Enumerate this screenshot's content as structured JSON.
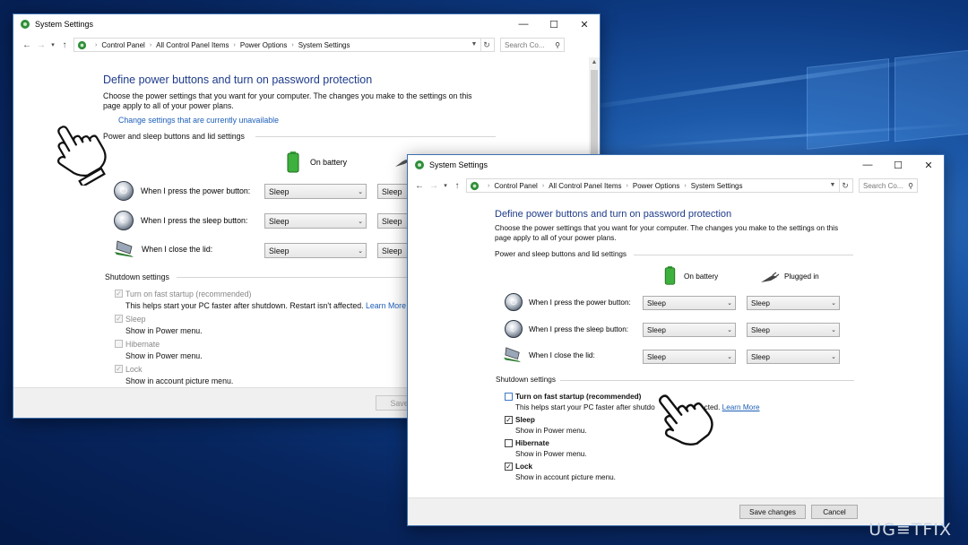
{
  "window_back": {
    "title": "System Settings",
    "breadcrumbs": [
      "Control Panel",
      "All Control Panel Items",
      "Power Options",
      "System Settings"
    ],
    "search_placeholder": "Search Co...",
    "heading": "Define power buttons and turn on password protection",
    "description": "Choose the power settings that you want for your computer. The changes you make to the settings on this page apply to all of your power plans.",
    "change_link": "Change settings that are currently unavailable",
    "section_power": "Power and sleep buttons and lid settings",
    "col_battery": "On battery",
    "rows": [
      {
        "label": "When I press the power button:",
        "battery": "Sleep",
        "plugged": "Sleep"
      },
      {
        "label": "When I press the sleep button:",
        "battery": "Sleep",
        "plugged": "Sleep"
      },
      {
        "label": "When I close the lid:",
        "battery": "Sleep",
        "plugged": "Sleep"
      }
    ],
    "section_shutdown": "Shutdown settings",
    "shutdown": [
      {
        "title": "Turn on fast startup (recommended)",
        "sub": "This helps start your PC faster after shutdown. Restart isn't affected.",
        "link": "Learn More",
        "checked": true
      },
      {
        "title": "Sleep",
        "sub": "Show in Power menu.",
        "checked": true
      },
      {
        "title": "Hibernate",
        "sub": "Show in Power menu.",
        "checked": false
      },
      {
        "title": "Lock",
        "sub": "Show in account picture menu.",
        "checked": true
      }
    ],
    "save_label": "Save c"
  },
  "window_front": {
    "title": "System Settings",
    "breadcrumbs": [
      "Control Panel",
      "All Control Panel Items",
      "Power Options",
      "System Settings"
    ],
    "search_placeholder": "Search Co...",
    "heading": "Define power buttons and turn on password protection",
    "description": "Choose the power settings that you want for your computer. The changes you make to the settings on this page apply to all of your power plans.",
    "section_power": "Power and sleep buttons and lid settings",
    "col_battery": "On battery",
    "col_plugged": "Plugged in",
    "rows": [
      {
        "label": "When I press the power button:",
        "battery": "Sleep",
        "plugged": "Sleep"
      },
      {
        "label": "When I press the sleep button:",
        "battery": "Sleep",
        "plugged": "Sleep"
      },
      {
        "label": "When I close the lid:",
        "battery": "Sleep",
        "plugged": "Sleep"
      }
    ],
    "section_shutdown": "Shutdown settings",
    "shutdown": [
      {
        "title": "Turn on fast startup (recommended)",
        "sub": "This helps start your PC faster after shutdo",
        "sub_tail": "ffected.",
        "link": "Learn More",
        "checked": false
      },
      {
        "title": "Sleep",
        "sub": "Show in Power menu.",
        "checked": true
      },
      {
        "title": "Hibernate",
        "sub": "Show in Power menu.",
        "checked": false
      },
      {
        "title": "Lock",
        "sub": "Show in account picture menu.",
        "checked": true
      }
    ],
    "save_label": "Save changes",
    "cancel_label": "Cancel"
  },
  "watermark": "UG≡TFIX",
  "colors": {
    "heading": "#1e3b8a",
    "link": "#1d5fb8",
    "desktop": "#0d3a82"
  }
}
